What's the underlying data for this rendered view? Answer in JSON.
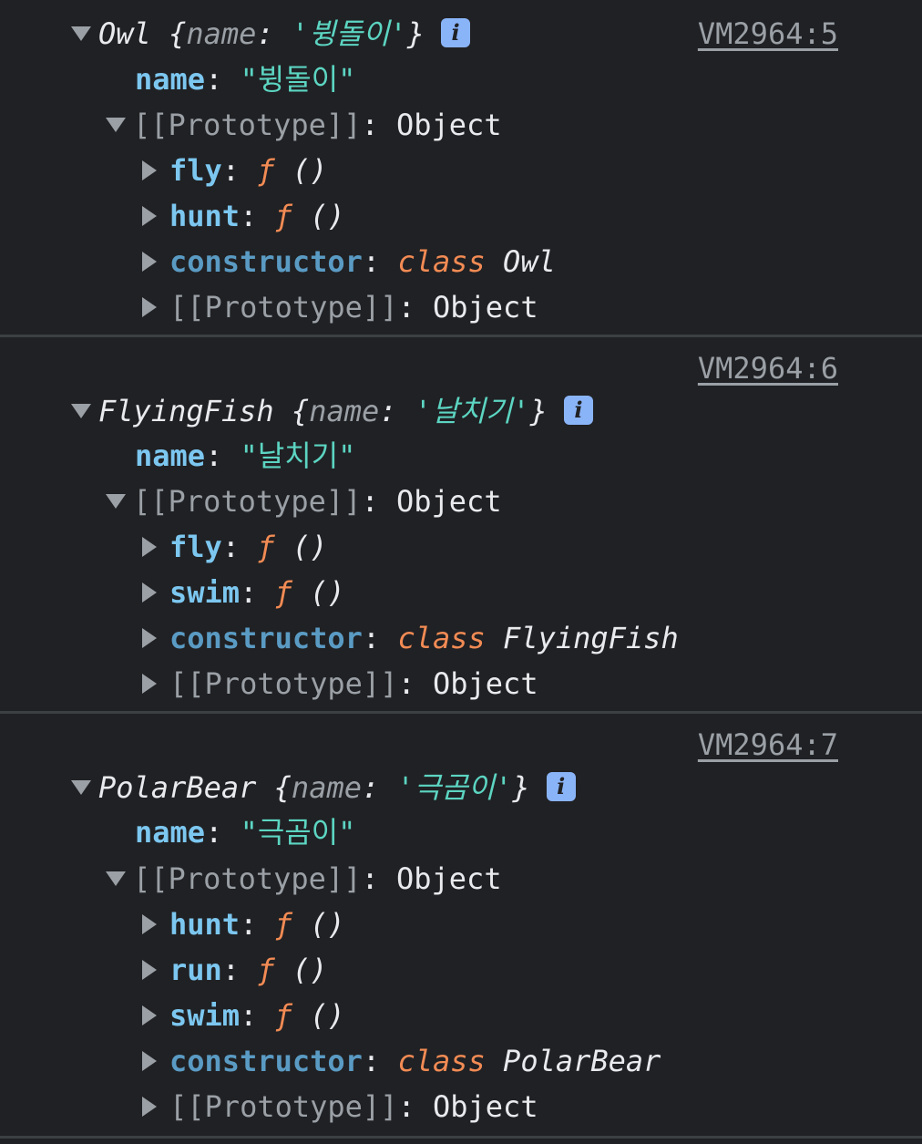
{
  "entries": [
    {
      "source": "VM2964:5",
      "class_name": "Owl",
      "preview_key": "name",
      "preview_value": "'뷩돌이'",
      "name_key": "name",
      "name_value": "\"뷩돌이\"",
      "proto_label": "[[Prototype]]",
      "proto_type": "Object",
      "methods": [
        {
          "key": "fly",
          "fn": "ƒ",
          "parens": "()"
        },
        {
          "key": "hunt",
          "fn": "ƒ",
          "parens": "()"
        }
      ],
      "constructor_key": "constructor",
      "constructor_kw": "class",
      "constructor_name": "Owl",
      "inner_proto_label": "[[Prototype]]",
      "inner_proto_type": "Object"
    },
    {
      "source": "VM2964:6",
      "class_name": "FlyingFish",
      "preview_key": "name",
      "preview_value": "'날치기'",
      "name_key": "name",
      "name_value": "\"날치기\"",
      "proto_label": "[[Prototype]]",
      "proto_type": "Object",
      "methods": [
        {
          "key": "fly",
          "fn": "ƒ",
          "parens": "()"
        },
        {
          "key": "swim",
          "fn": "ƒ",
          "parens": "()"
        }
      ],
      "constructor_key": "constructor",
      "constructor_kw": "class",
      "constructor_name": "FlyingFish",
      "inner_proto_label": "[[Prototype]]",
      "inner_proto_type": "Object"
    },
    {
      "source": "VM2964:7",
      "class_name": "PolarBear",
      "preview_key": "name",
      "preview_value": "'극곰이'",
      "name_key": "name",
      "name_value": "\"극곰이\"",
      "proto_label": "[[Prototype]]",
      "proto_type": "Object",
      "methods": [
        {
          "key": "hunt",
          "fn": "ƒ",
          "parens": "()"
        },
        {
          "key": "run",
          "fn": "ƒ",
          "parens": "()"
        },
        {
          "key": "swim",
          "fn": "ƒ",
          "parens": "()"
        }
      ],
      "constructor_key": "constructor",
      "constructor_kw": "class",
      "constructor_name": "PolarBear",
      "inner_proto_label": "[[Prototype]]",
      "inner_proto_type": "Object"
    }
  ],
  "info_glyph": "i",
  "colors": {
    "background": "#202124",
    "key": "#7cc7f0",
    "string": "#5cd5c2",
    "function": "#f28b54",
    "info_badge": "#8ab4f8"
  }
}
